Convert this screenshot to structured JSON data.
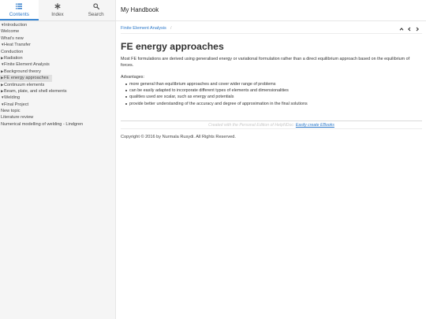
{
  "tabs": [
    {
      "label": "Contents",
      "icon": "contents-list-icon"
    },
    {
      "label": "Index",
      "icon": "index-asterisk-icon"
    },
    {
      "label": "Search",
      "icon": "search-icon"
    }
  ],
  "app_title": "My Handbook",
  "toc": [
    {
      "label": "Introduction",
      "expander": "expanded"
    },
    {
      "label": "Welcome",
      "expander": "none"
    },
    {
      "label": "What's new",
      "expander": "none"
    },
    {
      "label": "Heat Transfer",
      "expander": "expanded"
    },
    {
      "label": "Conduction",
      "expander": "none"
    },
    {
      "label": "Radiation",
      "expander": "collapsed"
    },
    {
      "label": "Finite Element Analysis",
      "expander": "expanded"
    },
    {
      "label": "Background theory",
      "expander": "collapsed"
    },
    {
      "label": "FE energy approaches",
      "expander": "collapsed",
      "selected": true
    },
    {
      "label": "Continuum elements",
      "expander": "collapsed"
    },
    {
      "label": "Beam, plate, and shell elements",
      "expander": "collapsed"
    },
    {
      "label": "Welding",
      "expander": "expanded"
    },
    {
      "label": "Final Project",
      "expander": "expanded"
    },
    {
      "label": "New topic",
      "expander": "none"
    },
    {
      "label": "Literature review",
      "expander": "none"
    },
    {
      "label": "Numerical modelling of welding - Lindgren",
      "expander": "none"
    }
  ],
  "breadcrumb": "Finite Element Analysis",
  "breadcrumb_separator": "/",
  "nav_icons": [
    "chevron-up-icon",
    "chevron-left-icon",
    "chevron-right-icon"
  ],
  "page": {
    "title": "FE energy approaches",
    "intro": "Most FE formulations are derived using generalised energy or variational formulation rather than a direct equilibrium approach based on the equilibrium of forces.",
    "advantages_label": "Advantages:",
    "advantages": [
      "more general than equilibrium approaches and cover wider range of problems",
      "can be easily adapted to incorporate different types of elements and dimensionalities",
      "qualities used are scalar, such as energy and potentials",
      "provide better understanding of the accuracy and degree of approximation in the final solutions"
    ]
  },
  "footer": {
    "created_prefix": "Created with the Personal Edition of HelpNDoc:",
    "created_link": "Easily create EBooks",
    "copyright": "Copyright © 2016 by Nurmala Rusydi. All Rights Reserved."
  },
  "colors": {
    "accent": "#2b78c9",
    "sidebar_bg": "#f5f5f5",
    "selected_bg": "#e0e0e0"
  }
}
